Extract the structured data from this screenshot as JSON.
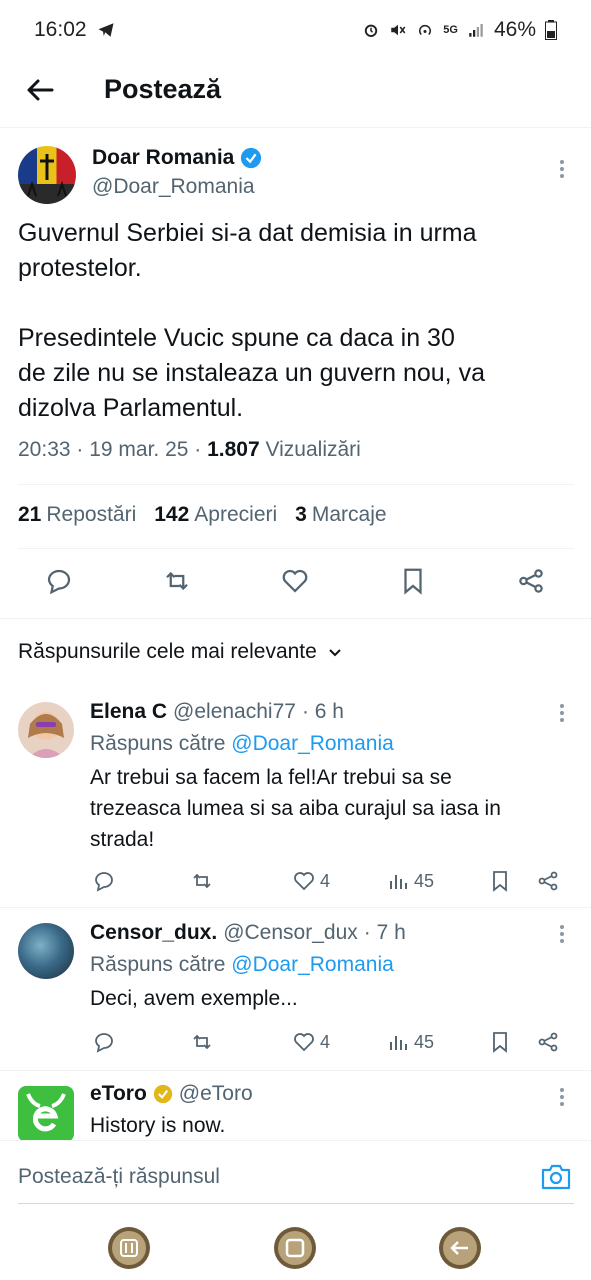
{
  "status_bar": {
    "time": "16:02",
    "battery": "46%",
    "network": "5G"
  },
  "header": {
    "title": "Postează"
  },
  "post": {
    "author_name": "Doar Romania",
    "author_handle": "@Doar_Romania",
    "text": "Guvernul Serbiei si-a dat demisia in urma\nprotestelor.\n\nPresedintele Vucic spune ca daca in 30\nde zile nu se instaleaza un guvern nou, va\ndizolva Parlamentul.",
    "timestamp": "20:33 · 19 mar. 25 · ",
    "views_count": "1.807",
    "views_label": "Vizualizări",
    "reposts_count": "21",
    "reposts_label": "Repostări",
    "likes_count": "142",
    "likes_label": "Aprecieri",
    "bookmarks_count": "3",
    "bookmarks_label": "Marcaje"
  },
  "sort_label": "Răspunsurile cele mai relevante",
  "replies": [
    {
      "name": "Elena C",
      "handle": "@elenachi77",
      "time": "· 6 h",
      "reply_to_label": "Răspuns către ",
      "reply_to_handle": "@Doar_Romania",
      "text": "Ar trebui sa facem la fel!Ar trebui sa se\ntrezeasca lumea si sa aiba curajul sa iasa in\nstrada!",
      "likes": "4",
      "views": "45"
    },
    {
      "name": "Censor_dux.",
      "handle": "@Censor_dux",
      "time": "· 7 h",
      "reply_to_label": "Răspuns către ",
      "reply_to_handle": "@Doar_Romania",
      "text": "Deci, avem exemple...",
      "likes": "4",
      "views": "45"
    },
    {
      "name": "eToro",
      "handle": "@eToro",
      "text": "History is now."
    }
  ],
  "composer": {
    "placeholder": "Postează-ți răspunsul"
  },
  "colors": {
    "accent": "#1d9bf0",
    "verified_blue": "#1d9bf0",
    "verified_gold": "#e2b719",
    "etoro_green": "#3fbf3f"
  }
}
